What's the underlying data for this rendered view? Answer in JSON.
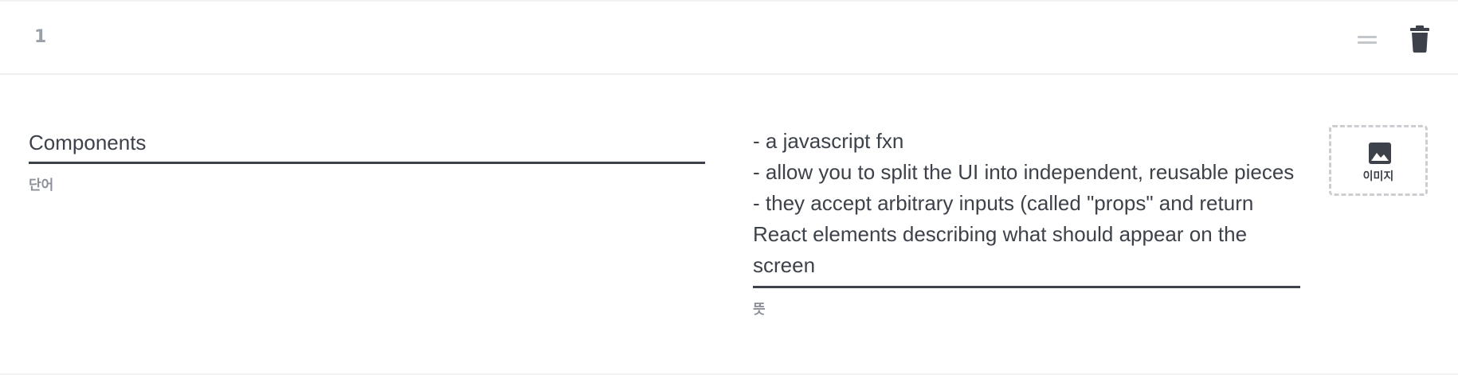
{
  "card": {
    "index": "1",
    "term": {
      "value": "Components",
      "label": "단어"
    },
    "definition": {
      "value": "- a javascript fxn\n- allow you to split the UI into independent, reusable pieces\n- they accept arbitrary inputs (called \"props\" and return React elements describing what should appear on the screen",
      "label": "뜻"
    },
    "image_button": {
      "label": "이미지",
      "icon": "image-icon"
    },
    "actions": {
      "drag_icon": "drag-handle-icon",
      "delete_icon": "trash-icon"
    }
  },
  "colors": {
    "text": "#3d424a",
    "muted": "#8c9199",
    "index": "#9aa0a8",
    "divider": "#eeeff1",
    "dashed_border": "#ccced2"
  }
}
